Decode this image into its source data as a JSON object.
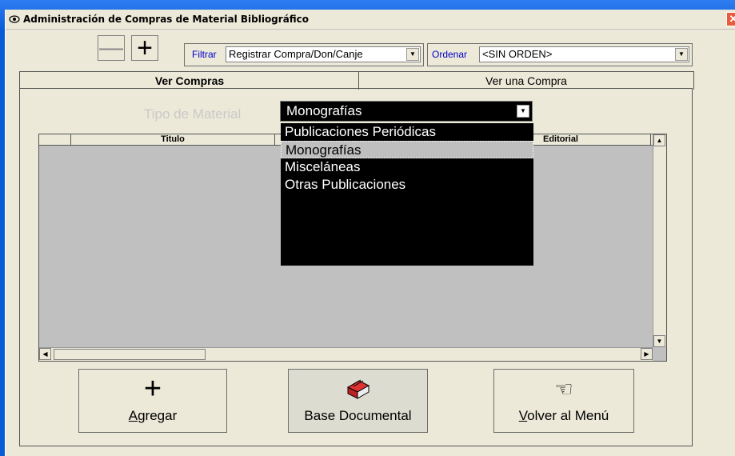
{
  "window": {
    "title": "Administración de Compras de Material Bibliográfico",
    "close_glyph": "✕",
    "app_icon": "eye-icon"
  },
  "toolbar": {
    "minus_glyph": "—",
    "plus_glyph": "+",
    "filter_label": "Filtrar",
    "filter_value": "Registrar Compra/Don/Canje",
    "order_label": "Ordenar",
    "order_value": "<SIN ORDEN>"
  },
  "tabs": [
    {
      "label": "Ver Compras",
      "active": true
    },
    {
      "label": "Ver una Compra",
      "active": false
    }
  ],
  "material": {
    "label": "Tipo de Material",
    "selected": "Monografías",
    "options": [
      "Publicaciones Periódicas",
      "Monografías",
      "Misceláneas",
      "Otras Publicaciones"
    ]
  },
  "grid": {
    "columns": [
      "",
      "Titulo",
      "Editorial",
      ""
    ]
  },
  "buttons": {
    "agregar": {
      "prefix": "A",
      "rest": "gregar",
      "glyph": "+"
    },
    "base": {
      "label": "Base Documental",
      "glyph": "🗃"
    },
    "volver": {
      "prefix": "V",
      "rest": "olver al Menú",
      "glyph": "☜"
    }
  },
  "colors": {
    "desktop": "#0a5bd9",
    "window": "#ece9d8",
    "accent_text": "#0000cc",
    "dropdown_bg": "#000000",
    "selected_option": "#bfbfbf"
  }
}
